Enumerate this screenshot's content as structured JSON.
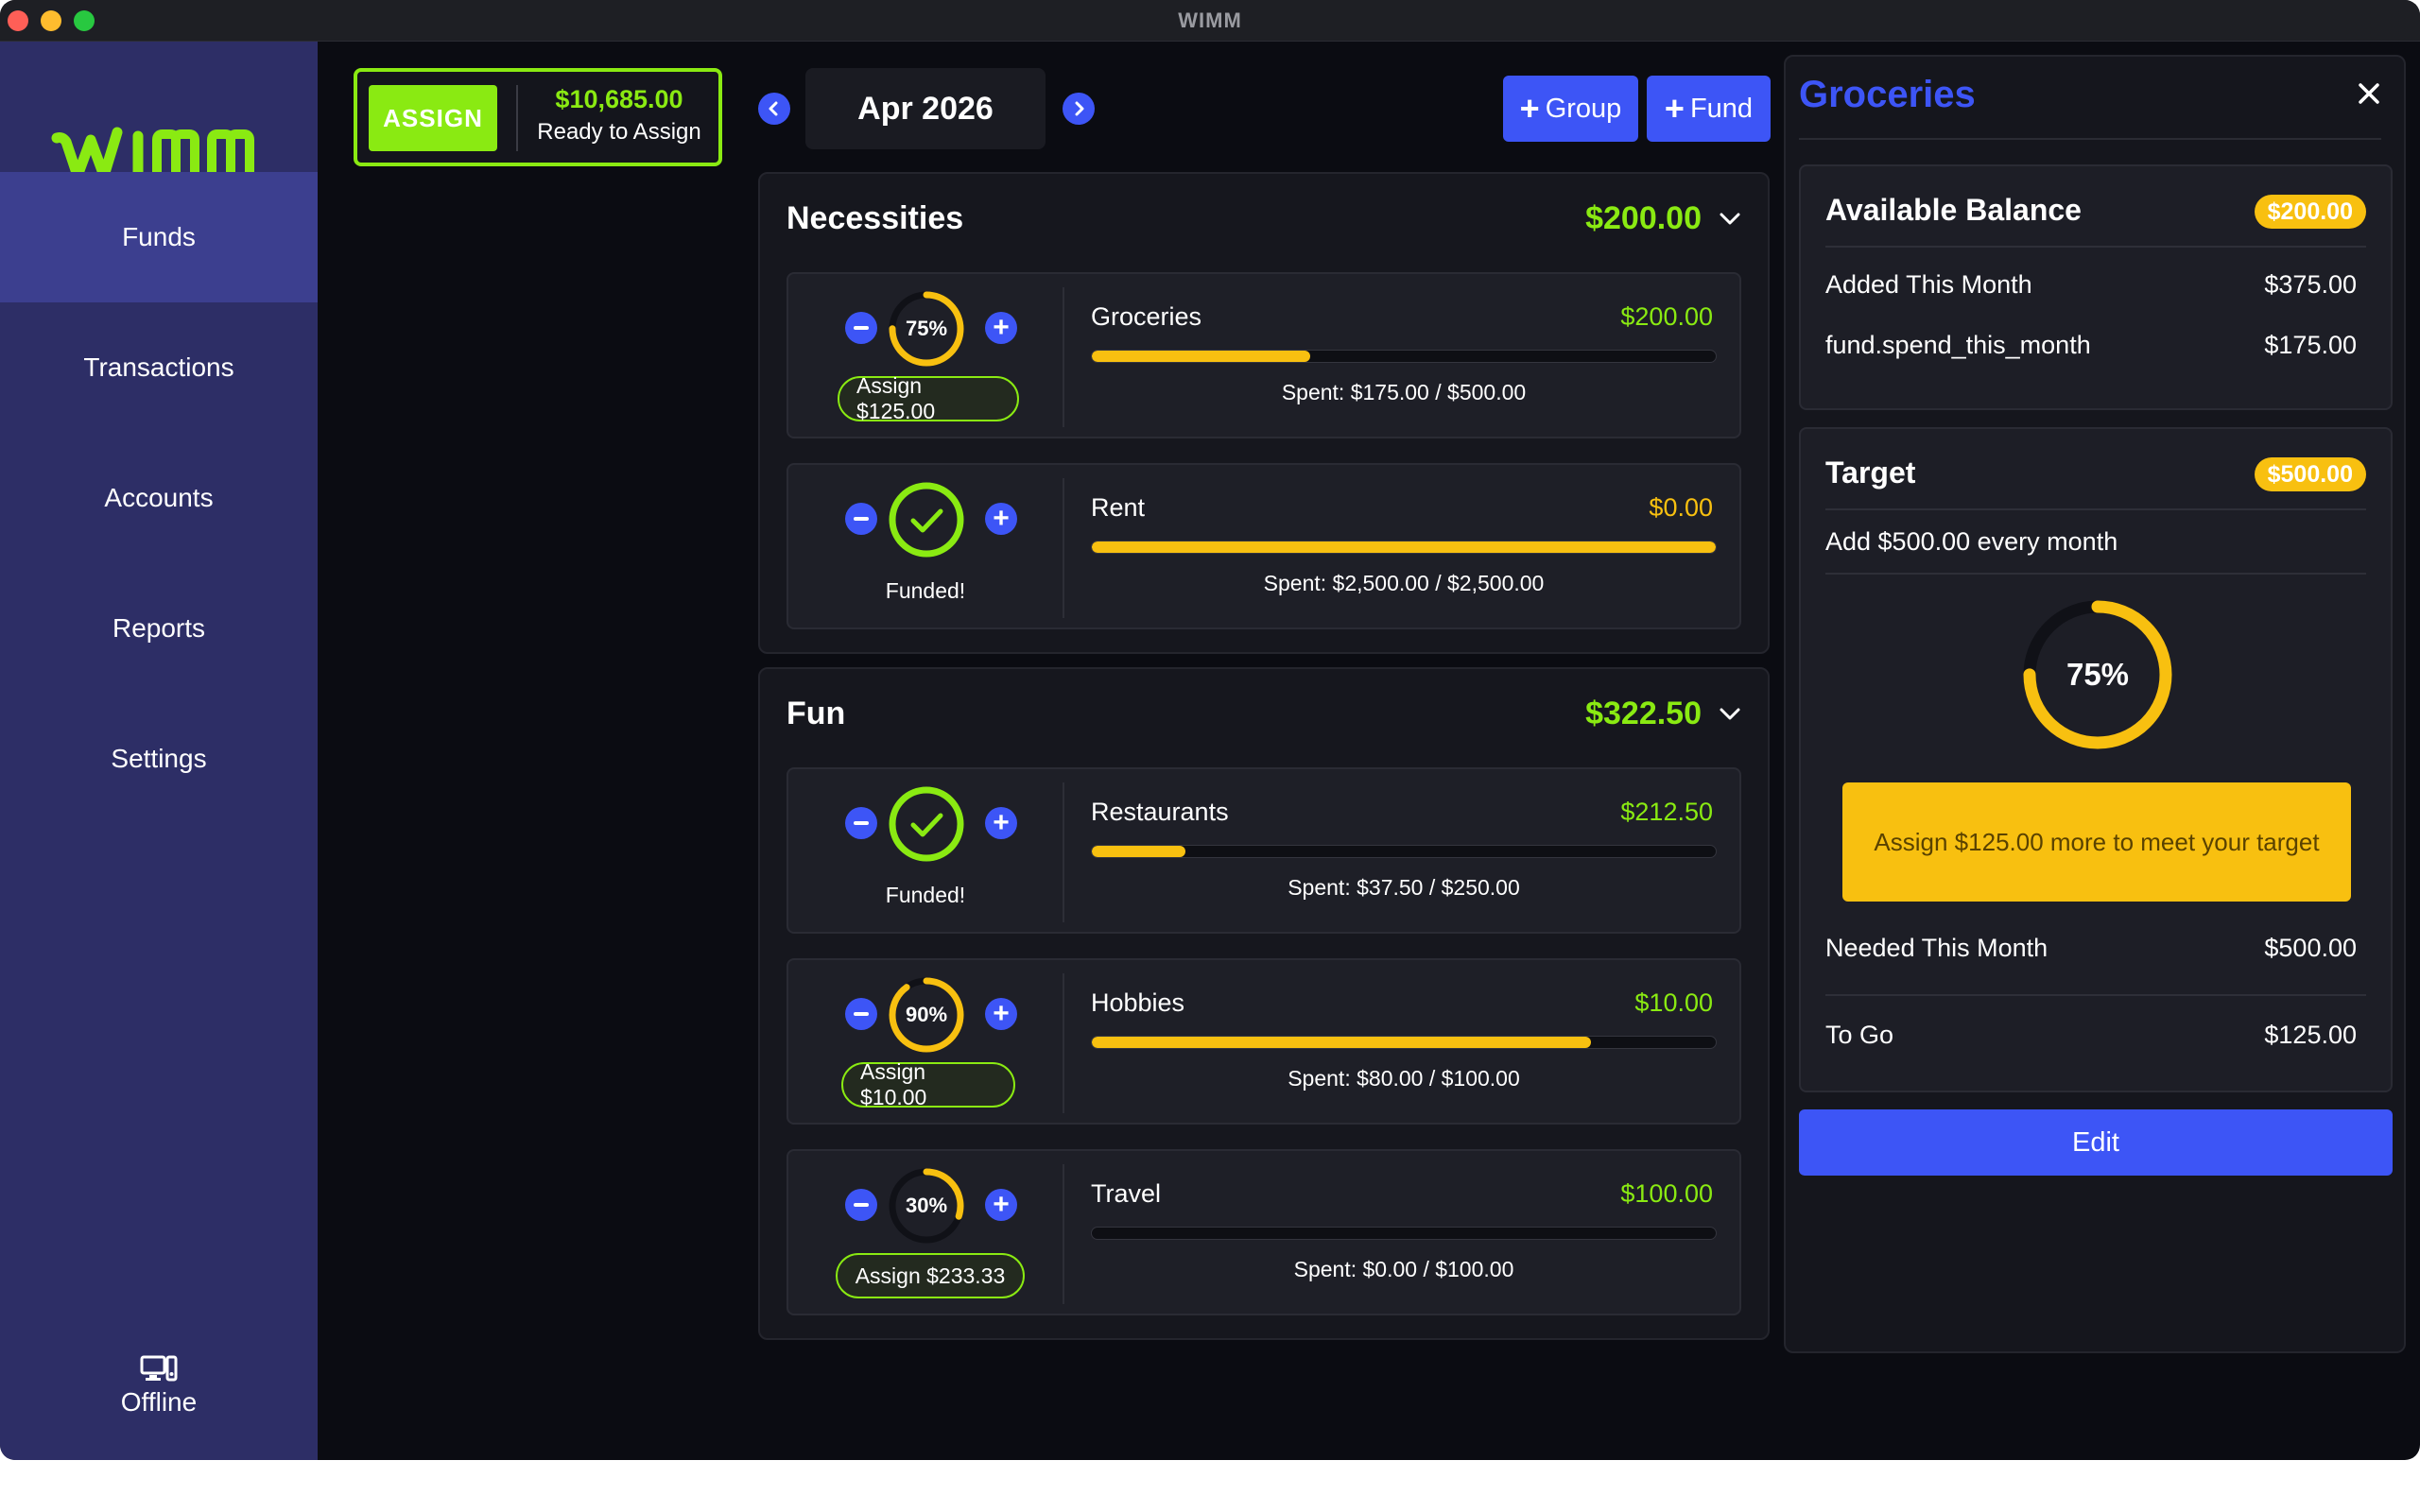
{
  "window": {
    "title": "WIMM"
  },
  "colors": {
    "accent_green": "#8aea12",
    "accent_blue": "#3d55f6",
    "accent_yellow": "#f8c010",
    "sidebar_bg": "#2d2e66"
  },
  "sidebar": {
    "logo": "WIMM",
    "items": [
      {
        "label": "Funds",
        "active": true
      },
      {
        "label": "Transactions",
        "active": false
      },
      {
        "label": "Accounts",
        "active": false
      },
      {
        "label": "Reports",
        "active": false
      },
      {
        "label": "Settings",
        "active": false
      }
    ],
    "status": {
      "label": "Offline",
      "icon": "computer-icon"
    }
  },
  "assign": {
    "button_label": "ASSIGN",
    "amount": "$10,685.00",
    "label": "Ready to Assign"
  },
  "month_nav": {
    "month": "Apr 2026",
    "prev_icon": "chevron-left-icon",
    "next_icon": "chevron-right-icon"
  },
  "toolbar": {
    "group_label": "Group",
    "fund_label": "Fund"
  },
  "groups": [
    {
      "name": "Necessities",
      "amount": "$200.00",
      "funds": [
        {
          "name": "Groceries",
          "available": "$200.00",
          "available_color": "#8aea12",
          "spent": "Spent: $175.00 / $500.00",
          "spent_ratio": 0.35,
          "progress_label": "75%",
          "progress": 0.75,
          "funded": false,
          "assign_label": "Assign $125.00"
        },
        {
          "name": "Rent",
          "available": "$0.00",
          "available_color": "#f8c010",
          "spent": "Spent: $2,500.00 / $2,500.00",
          "spent_ratio": 1.0,
          "progress_label": "",
          "progress": 1.0,
          "funded": true,
          "funded_label": "Funded!"
        }
      ]
    },
    {
      "name": "Fun",
      "amount": "$322.50",
      "funds": [
        {
          "name": "Restaurants",
          "available": "$212.50",
          "available_color": "#8aea12",
          "spent": "Spent: $37.50 / $250.00",
          "spent_ratio": 0.15,
          "progress_label": "",
          "progress": 1.0,
          "funded": true,
          "funded_label": "Funded!"
        },
        {
          "name": "Hobbies",
          "available": "$10.00",
          "available_color": "#8aea12",
          "spent": "Spent: $80.00 / $100.00",
          "spent_ratio": 0.8,
          "progress_label": "90%",
          "progress": 0.9,
          "funded": false,
          "assign_label": "Assign $10.00"
        },
        {
          "name": "Travel",
          "available": "$100.00",
          "available_color": "#8aea12",
          "spent": "Spent: $0.00 / $100.00",
          "spent_ratio": 0.0,
          "progress_label": "30%",
          "progress": 0.3,
          "funded": false,
          "assign_label": "Assign $233.33"
        }
      ]
    }
  ],
  "detail": {
    "title": "Groceries",
    "balance_card": {
      "title": "Available Balance",
      "badge": "$200.00",
      "rows": [
        {
          "label": "Added This Month",
          "value": "$375.00"
        },
        {
          "label": "fund.spend_this_month",
          "value": "$175.00"
        }
      ]
    },
    "target_card": {
      "title": "Target",
      "badge": "$500.00",
      "description": "Add $500.00 every month",
      "progress_label": "75%",
      "progress": 0.75,
      "warning": "Assign $125.00 more to meet your target",
      "rows": [
        {
          "label": "Needed This Month",
          "value": "$500.00"
        },
        {
          "label": "To Go",
          "value": "$125.00"
        }
      ]
    },
    "edit_label": "Edit"
  }
}
